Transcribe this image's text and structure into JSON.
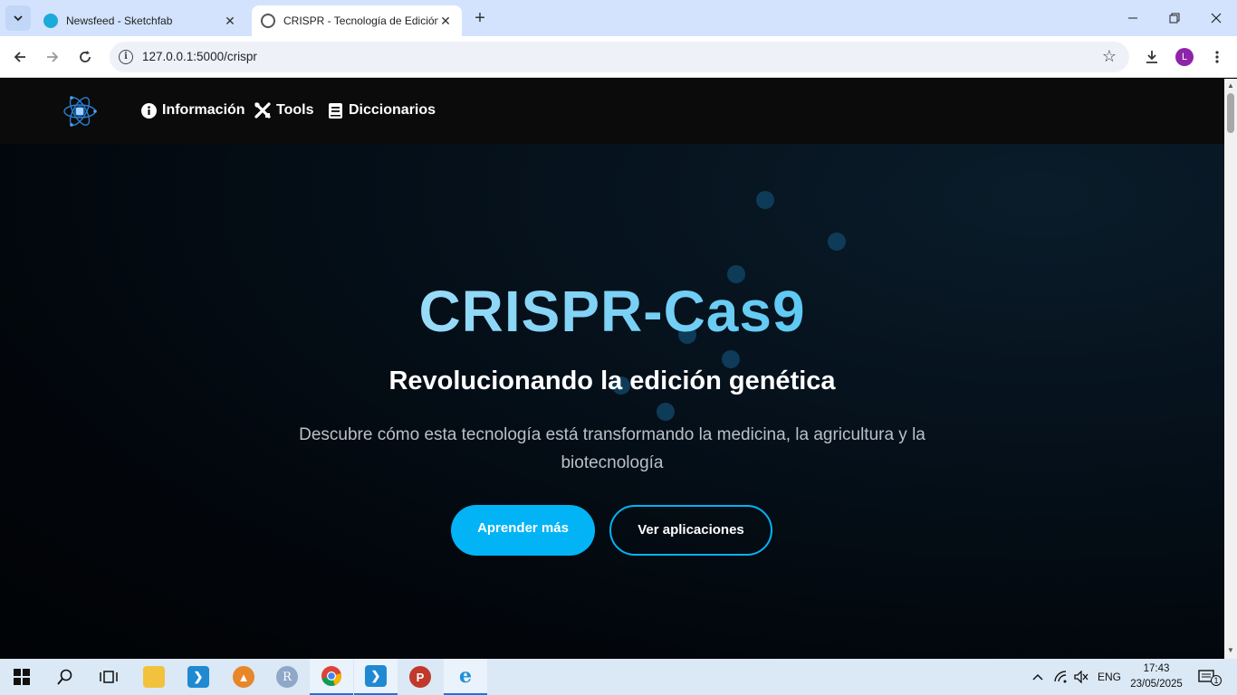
{
  "browser": {
    "tabs": [
      {
        "title": "Newsfeed - Sketchfab",
        "favicon": "sketchfab-icon"
      },
      {
        "title": "CRISPR - Tecnología de Edición",
        "favicon": "globe-icon"
      }
    ],
    "url": "127.0.0.1:5000/crispr",
    "profile_initial": "L"
  },
  "site": {
    "nav": [
      {
        "label": "Información",
        "icon": "info-icon"
      },
      {
        "label": "Tools",
        "icon": "tools-icon"
      },
      {
        "label": "Diccionarios",
        "icon": "book-icon"
      }
    ],
    "accent": "#02b4f5"
  },
  "hero": {
    "title": "CRISPR-Cas9",
    "subtitle": "Revolucionando la edición genética",
    "description": "Descubre cómo esta tecnología está transformando la medicina, la agricultura y la biotecnología",
    "primary_button": "Aprender más",
    "secondary_button": "Ver aplicaciones"
  },
  "taskbar": {
    "apps": [
      "windows-start",
      "search",
      "task-view",
      "file-explorer",
      "vscode",
      "app-orange",
      "r-language",
      "chrome",
      "vscode",
      "app-red",
      "internet-explorer"
    ],
    "language": "ENG",
    "time": "17:43",
    "date": "23/05/2025",
    "notifications": "1"
  }
}
